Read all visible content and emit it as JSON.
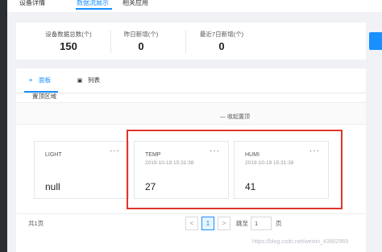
{
  "top_tabs": [
    {
      "label": "设备详情"
    },
    {
      "label": "数据流展示",
      "active": true
    },
    {
      "label": "相关应用"
    }
  ],
  "stats": [
    {
      "label": "设备数据总数(个)",
      "value": "150"
    },
    {
      "label": "昨日新增(个)",
      "value": "0"
    },
    {
      "label": "最近7日新增(个)",
      "value": "0"
    }
  ],
  "view_tabs": [
    {
      "label": "面板",
      "icon": "grid-icon",
      "active": true
    },
    {
      "label": "列表",
      "icon": "list-icon"
    }
  ],
  "pin_area": {
    "label": "置顶区域",
    "collapse_label": "收起置顶"
  },
  "cards": [
    {
      "title": "LIGHT",
      "time": "",
      "value": "null"
    },
    {
      "title": "TEMP",
      "time": "2019-10-19 15:31:38",
      "value": "27"
    },
    {
      "title": "HUMI",
      "time": "2019-10-19 15:31:38",
      "value": "41"
    }
  ],
  "pagination": {
    "total": "共1页",
    "prev": "<",
    "current": "1",
    "next": ">",
    "goto_label": "跳至",
    "goto_value": "1",
    "page_suffix": "页"
  },
  "watermark": "https://blog.csdn.net/weixin_43902969",
  "colors": {
    "accent": "#1890ff",
    "highlight": "#e0352b",
    "sidebar": "#2b2f33"
  }
}
